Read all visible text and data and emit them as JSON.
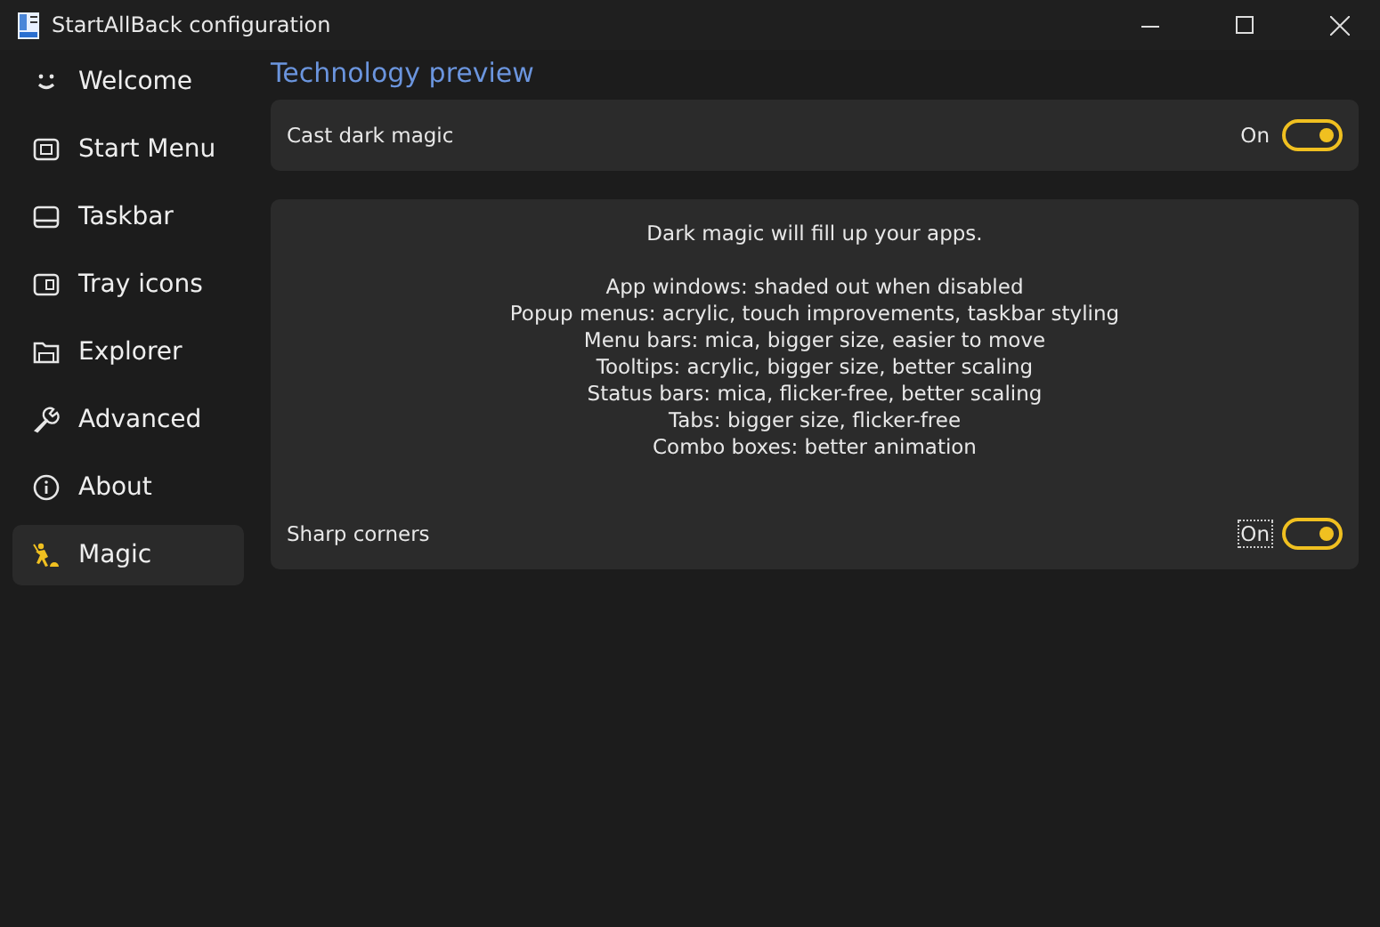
{
  "window": {
    "title": "StartAllBack configuration"
  },
  "sidebar": {
    "items": [
      {
        "kind": "smile",
        "label": "Welcome",
        "selected": false
      },
      {
        "kind": "start",
        "label": "Start Menu",
        "selected": false
      },
      {
        "kind": "taskbar",
        "label": "Taskbar",
        "selected": false
      },
      {
        "kind": "tray",
        "label": "Tray icons",
        "selected": false
      },
      {
        "kind": "folder",
        "label": "Explorer",
        "selected": false
      },
      {
        "kind": "wrench",
        "label": "Advanced",
        "selected": false
      },
      {
        "kind": "info",
        "label": "About",
        "selected": false
      },
      {
        "kind": "magic",
        "label": "Magic",
        "selected": true
      }
    ]
  },
  "heading": "Technology preview",
  "cast_dark_magic": {
    "label": "Cast dark magic",
    "state_text": "On",
    "on": true,
    "focused": false
  },
  "magic_card": {
    "intro": "Dark magic will fill up your apps.",
    "lines": [
      "App windows: shaded out when disabled",
      "Popup menus: acrylic, touch improvements, taskbar styling",
      "Menu bars: mica, bigger size, easier to move",
      "Tooltips: acrylic, bigger size, better scaling",
      "Status bars: mica, flicker-free, better scaling",
      "Tabs: bigger size, flicker-free",
      "Combo boxes: better animation"
    ],
    "sharp_corners": {
      "label": "Sharp corners",
      "state_text": "On",
      "on": true,
      "focused": true
    }
  }
}
